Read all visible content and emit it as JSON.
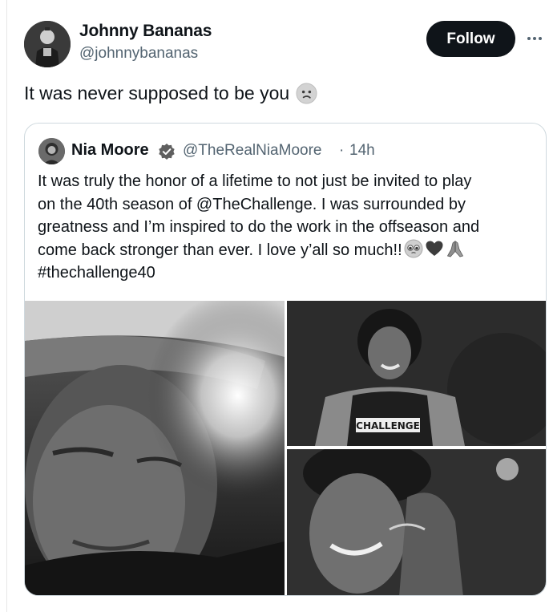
{
  "author": {
    "name": "Johnny Bananas",
    "handle": "@johnnybananas",
    "avatar_icon": "profile-photo"
  },
  "actions": {
    "follow_label": "Follow",
    "more_icon": "ellipsis-icon"
  },
  "tweet": {
    "text": "It was never supposed to be you",
    "emoji": "confused-face"
  },
  "quoted_tweet": {
    "name": "Nia Moore",
    "verified_icon": "verified-badge-icon",
    "handle": "@TheRealNiaMoore",
    "separator": "·",
    "time": "14h",
    "lines": [
      "It was truly the honor of a lifetime to not just be invited to play",
      "on the 40th season of @TheChallenge. I was surrounded by",
      "greatness and I’m inspired to do the work in the offseason and",
      "come back stronger than ever. I love y’all so much!!",
      "#thechallenge40"
    ],
    "line4_emojis": [
      "pleading-face",
      "black-heart",
      "folded-hands"
    ],
    "media": [
      {
        "name": "photo-helmet-closeup"
      },
      {
        "name": "photo-challenge-tank-top",
        "shirt_text": "CHALLENGE"
      },
      {
        "name": "photo-smiling-closeup"
      }
    ]
  },
  "colors": {
    "text_primary": "#0f1419",
    "text_secondary": "#536471",
    "border": "#cfd9de",
    "follow_bg": "#0f1419"
  }
}
